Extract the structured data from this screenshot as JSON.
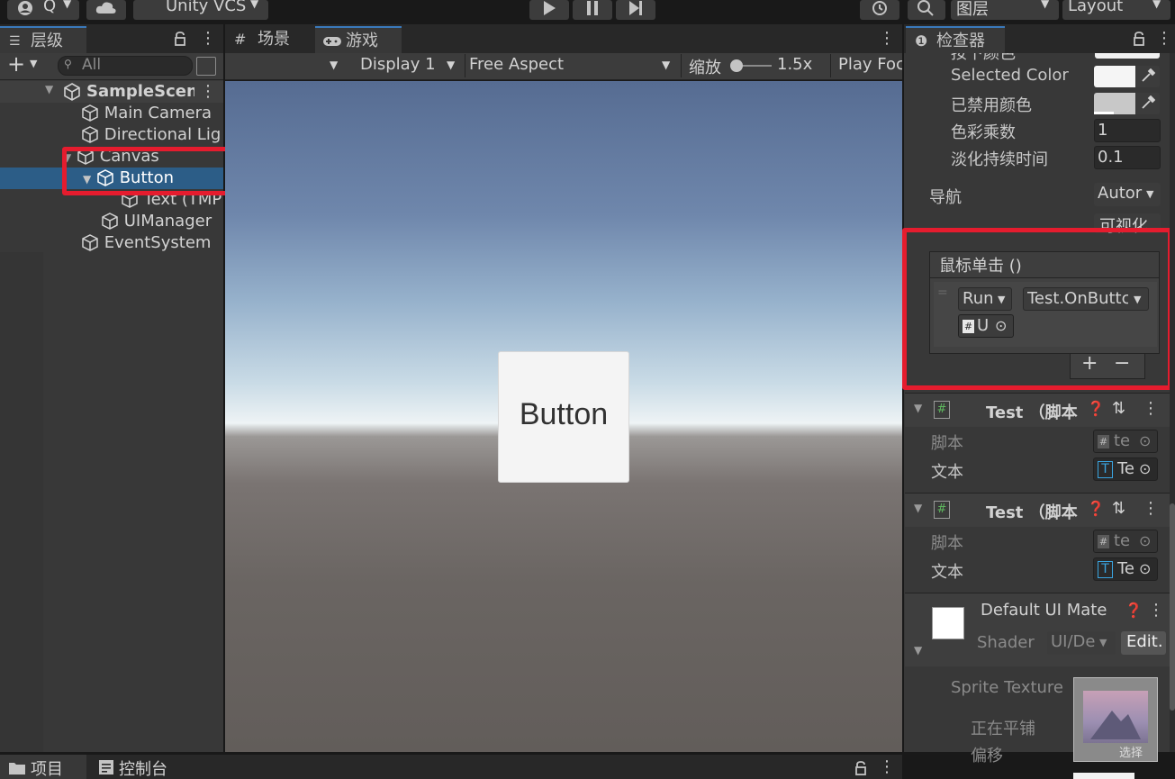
{
  "toolbar": {
    "account_label": "Q",
    "vcs_label": "Unity VCS",
    "layers_label": "图层",
    "layout_label": "Layout"
  },
  "hierarchy": {
    "tab_label": "层级",
    "search_placeholder": "All",
    "scene_name": "SampleScene",
    "items": [
      {
        "label": "Main Camera"
      },
      {
        "label": "Directional Lig"
      },
      {
        "label": "Canvas"
      },
      {
        "label": "Button"
      },
      {
        "label": "Text (TMP"
      },
      {
        "label": "UIManager"
      },
      {
        "label": "EventSystem"
      }
    ]
  },
  "game": {
    "scene_tab": "场景",
    "game_tab": "游戏",
    "display_label": "Display 1",
    "aspect_label": "Free Aspect",
    "zoom_label": "缩放",
    "zoom_value": "1.5x",
    "play_focused": "Play Foc",
    "button_text": "Button"
  },
  "inspector": {
    "tab_label": "检查器",
    "cutoff_label": "按下颜色",
    "selected_color_label": "Selected Color",
    "disabled_color_label": "已禁用颜色",
    "color_multiplier_label": "色彩乘数",
    "color_multiplier_value": "1",
    "fade_duration_label": "淡化持续时间",
    "fade_duration_value": "0.1",
    "navigation_label": "导航",
    "navigation_value": "Autor",
    "visualize_label": "可视化",
    "event_title": "鼠标单击 ()",
    "runtime_value": "Run",
    "function_value": "Test.OnButtc",
    "object_value": "U",
    "plus": "+",
    "minus": "−",
    "components": [
      {
        "title": "Test （脚本",
        "script_label": "脚本",
        "script_value": "te",
        "text_label": "文本",
        "text_value": "Te"
      },
      {
        "title": "Test （脚本",
        "script_label": "脚本",
        "script_value": "te",
        "text_label": "文本",
        "text_value": "Te"
      }
    ],
    "material_title": "Default UI Mate",
    "shader_label": "Shader",
    "shader_value": "UI/De",
    "edit_label": "Edit.",
    "sprite_texture_label": "Sprite Texture",
    "tiling_label": "正在平铺",
    "offset_label": "偏移",
    "select_label": "选择"
  },
  "bottom": {
    "project_tab": "项目",
    "console_tab": "控制台"
  },
  "colors": {
    "selection": "#2c5d87",
    "accent": "#3a79bb",
    "highlight_box": "#e51c2e"
  }
}
